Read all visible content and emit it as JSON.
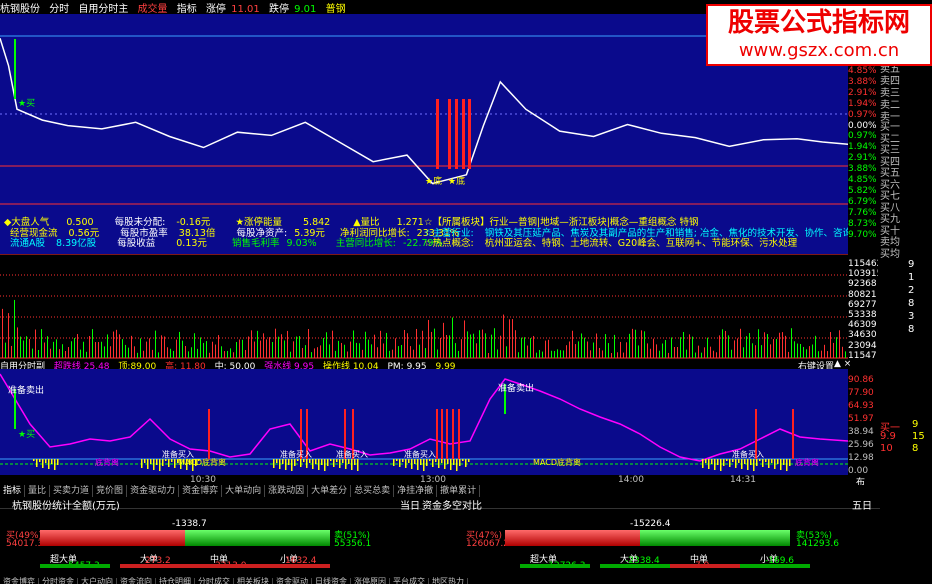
{
  "title_bar": {
    "stock": "杭钢股份",
    "items": [
      "分时",
      "自用分时主"
    ],
    "volume_label": "成交量",
    "indicator_label": "指标",
    "rise_stop": "涨停",
    "rise_stop_value": "11.01",
    "fall_stop": "跌停",
    "fall_stop_value": "9.01",
    "steel": "普钢"
  },
  "watermark": {
    "line1": "股票公式指标网",
    "line2": "www.gszx.com.cn"
  },
  "price_scale": [
    "4.85%",
    "3.88%",
    "2.91%",
    "1.94%",
    "0.97%",
    "0.00%",
    "0.97%",
    "1.94%",
    "2.91%",
    "3.88%",
    "4.85%",
    "5.82%",
    "6.79%",
    "7.76%",
    "8.73%",
    "9.70%"
  ],
  "volume_scale": [
    "115462",
    "103915",
    "92368",
    "80821",
    "69277",
    "53338",
    "46309",
    "34630",
    "23094",
    "11547"
  ],
  "order_book": {
    "sell": [
      "卖五",
      "卖四",
      "卖三",
      "卖二",
      "卖一"
    ],
    "buy": [
      "买一",
      "买二",
      "买三",
      "买四",
      "买五",
      "买六",
      "买七",
      "买八",
      "买九",
      "买十"
    ],
    "extra": [
      "卖均",
      "买均"
    ]
  },
  "labels": {
    "buy_star": "★买",
    "bottom1": "★底",
    "bottom2": "★底"
  },
  "info": {
    "row1": [
      {
        "k": "◆大盘人气",
        "v": "0.500"
      },
      {
        "k": "每股未分配:",
        "v": "-0.16元"
      },
      {
        "k": "★涨停能量",
        "v": "5.842"
      },
      {
        "k": "▲量比",
        "v": "1.271"
      }
    ],
    "row2": [
      {
        "k": "经营现金流",
        "v": "0.56元"
      },
      {
        "k": "每股市盈率",
        "v": "38.13倍"
      },
      {
        "k": "每股净资产:",
        "v": "5.39元"
      },
      {
        "k": "净利润同比增长:",
        "v": "233.31%"
      }
    ],
    "row3": [
      {
        "k": "流通A股",
        "v": "8.39亿股"
      },
      {
        "k": "每股收益",
        "v": "0.13元"
      },
      {
        "k": "销售毛利率",
        "v": "9.03%"
      },
      {
        "k": "主营同比增长:",
        "v": "-22.79%"
      }
    ],
    "right1": "☆【所属板块】行业—普钢|地域—浙江板块|概念—重组概念 特钢",
    "right2_k": "☆主营行业:",
    "right2_v": "钢铁及其压延产品、焦炭及其副产品的生产和销售; 冶金、焦化的技术开发、协作、咨询、服务与培训",
    "right3_k": "☆热点概念:",
    "right3_v": "杭州亚运会、特钢、土地流转、G20峰会、互联网+、节能环保、污水处理"
  },
  "ind_head": {
    "name": "自用分时副",
    "a": "超跌线 25.48",
    "b": "顶:89.00",
    "c": "高: 11.80",
    "d": "中: 50.00",
    "e": "强水线 9.95",
    "f": "操作线 10.04",
    "g": "PM: 9.95",
    "h": "9.99",
    "settings": "右键设置",
    "close": "▲ ×"
  },
  "ind_scale": [
    "90.86",
    "77.90",
    "64.93",
    "51.97",
    "38.94",
    "25.96",
    "12.98",
    "0.00"
  ],
  "ind_labels": {
    "sell_ready1": "准备卖出",
    "sell_ready2": "准备卖出",
    "buy_star": "★买",
    "buy_ready": [
      "准备买入",
      "准备买入",
      "准备买入",
      "准备买入",
      "准备买入"
    ],
    "sell_marks": [
      "卖",
      "卖",
      "卖",
      "卖",
      "卖",
      "卖",
      "卖",
      "卖"
    ],
    "macd": [
      "MACD底背离",
      "MACD底背离"
    ],
    "bottom": [
      "底背离",
      "底背离"
    ]
  },
  "time_axis": [
    "10:30",
    "13:00",
    "14:00",
    "14:31"
  ],
  "time_axis_right": "布局",
  "tabs_top": [
    "指标",
    "量比",
    "买卖力道",
    "竞价图",
    "资金驱动力",
    "资金博弈",
    "大单动向",
    "涨跌动因",
    "大单差分",
    "总买总卖",
    "净挂净撤",
    "撤单累计"
  ],
  "bottom_panel": {
    "left_title": "杭钢股份",
    "left_sub": "统计全额(万元)",
    "date": "当日",
    "right_title": "资金多空对比",
    "period": "五日",
    "left": {
      "buy_pct": "买(49%)",
      "buy_val": "54017.3",
      "sell_pct": "卖(51%)",
      "sell_val": "55356.1",
      "diff": "-1338.7",
      "cats": [
        {
          "name": "超大单",
          "v": "-5457.3"
        },
        {
          "name": "大单",
          "v": "273.2"
        },
        {
          "name": "中单",
          "v": "2213.0"
        },
        {
          "name": "小单",
          "v": "1632.4"
        }
      ]
    },
    "right": {
      "buy_pct": "买(47%)",
      "buy_val": "126067.2",
      "sell_pct": "卖(53%)",
      "sell_val": "141293.6",
      "diff": "-15226.4",
      "cats": [
        {
          "name": "超大单",
          "v": "-12726.3"
        },
        {
          "name": "大单",
          "v": "-2338.4"
        },
        {
          "name": "中单",
          "v": "7.9"
        },
        {
          "name": "小单",
          "v": "-169.6"
        }
      ]
    }
  },
  "bottom_tabs": [
    "资金博弈",
    "分时资金",
    "大户动向",
    "资金流向",
    "持仓明细",
    "分时成交",
    "相关板块",
    "资金驱动",
    "日线资金",
    "涨停原因",
    "平台成交",
    "地区热力"
  ],
  "right_side": {
    "nums": [
      "9",
      "1",
      "2",
      "8",
      "3",
      "8"
    ],
    "bottom_labels": [
      "买一",
      "9.9",
      "10"
    ],
    "bottom_vals": [
      "9",
      "15",
      "8"
    ]
  },
  "colors": {
    "chart_bg": "#0a0a8c",
    "price_line": "#ffffff",
    "red": "#ff2020",
    "green": "#00ff00",
    "yellow": "#ffff00",
    "magenta": "#ff00ff",
    "cyan": "#00ffff"
  },
  "chart_data": {
    "type": "line",
    "title": "",
    "series": [
      {
        "name": "price",
        "x_frac": [
          0,
          0.01,
          0.02,
          0.05,
          0.08,
          0.12,
          0.16,
          0.2,
          0.24,
          0.28,
          0.32,
          0.36,
          0.4,
          0.44,
          0.48,
          0.51,
          0.52,
          0.55,
          0.57,
          0.59,
          0.62,
          0.66,
          0.7,
          0.74,
          0.78,
          0.82,
          0.86,
          0.9,
          0.94,
          0.97,
          1.0
        ],
        "y_pct": [
          9.5,
          7.0,
          3.0,
          2.0,
          1.5,
          1.2,
          1.8,
          0.5,
          -0.5,
          0.9,
          0.6,
          1.8,
          0.0,
          -1.8,
          -1.2,
          -3.8,
          -3.6,
          -3.0,
          1.5,
          5.5,
          3.0,
          1.0,
          0.5,
          1.6,
          0.8,
          0.4,
          -0.4,
          0.2,
          0.3,
          0.0,
          -0.2
        ]
      }
    ],
    "ylim": [
      -9.7,
      9.7
    ]
  }
}
